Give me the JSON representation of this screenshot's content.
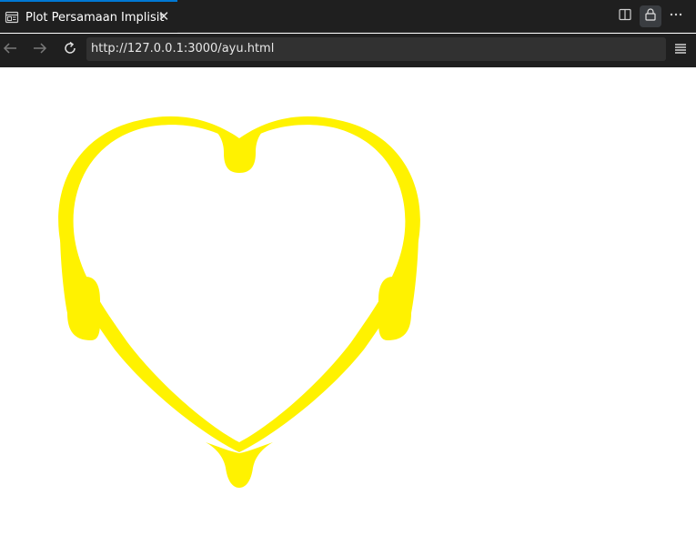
{
  "tab": {
    "title": "Plot Persamaan Implisit",
    "close_glyph": "✕",
    "icon": "page-icon"
  },
  "toolbar": {
    "back_icon": "back-arrow-icon",
    "forward_icon": "forward-arrow-icon",
    "reload_icon": "reload-icon",
    "split_icon": "split-editor-icon",
    "lock_icon": "lock-icon",
    "more_icon": "more-icon",
    "menu_icon": "menu-icon"
  },
  "address": {
    "url": "http://127.0.0.1:3000/ayu.html"
  },
  "chart_data": {
    "type": "heart",
    "title": "",
    "fill_color": "#fff200",
    "background": "#ffffff"
  }
}
